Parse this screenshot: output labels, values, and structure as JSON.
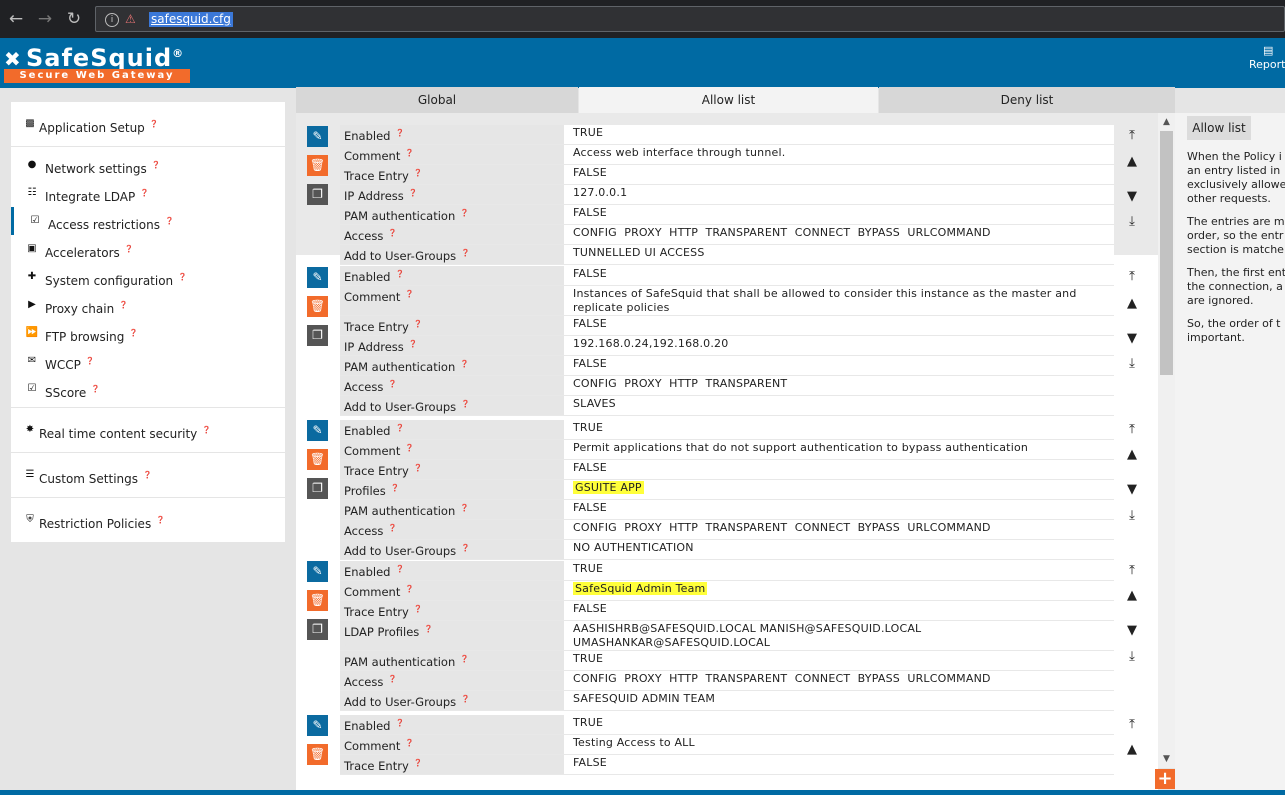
{
  "browser": {
    "url": "safesquid.cfg"
  },
  "app": {
    "logo_name": "SafeSquid",
    "logo_reg": "®",
    "logo_tagline": "Secure Web Gateway",
    "reports_label": "Report"
  },
  "sidebar": {
    "group1_title": "Application Setup",
    "items": [
      "Network settings",
      "Integrate LDAP",
      "Access restrictions",
      "Accelerators",
      "System configuration",
      "Proxy chain",
      "FTP browsing",
      "WCCP",
      "SScore"
    ],
    "group2_title": "Real time content security",
    "group3_title": "Custom Settings",
    "group4_title": "Restriction Policies"
  },
  "tabs": [
    {
      "label": "Global"
    },
    {
      "label": "Allow list"
    },
    {
      "label": "Deny list"
    }
  ],
  "entries": [
    {
      "rows": [
        {
          "k": "Enabled",
          "v": "TRUE"
        },
        {
          "k": "Comment",
          "v": "Access web interface through tunnel."
        },
        {
          "k": "Trace Entry",
          "v": "FALSE"
        },
        {
          "k": "IP Address",
          "v": "127.0.0.1"
        },
        {
          "k": "PAM authentication",
          "v": "FALSE"
        },
        {
          "k": "Access",
          "v": "CONFIG  PROXY  HTTP  TRANSPARENT  CONNECT  BYPASS  URLCOMMAND"
        },
        {
          "k": "Add to User-Groups",
          "v": "TUNNELLED UI ACCESS"
        }
      ]
    },
    {
      "rows": [
        {
          "k": "Enabled",
          "v": "FALSE"
        },
        {
          "k": "Comment",
          "v": "Instances of SafeSquid that shall be allowed to consider this instance as the master and replicate policies"
        },
        {
          "k": "Trace Entry",
          "v": "FALSE"
        },
        {
          "k": "IP Address",
          "v": "192.168.0.24,192.168.0.20"
        },
        {
          "k": "PAM authentication",
          "v": "FALSE"
        },
        {
          "k": "Access",
          "v": "CONFIG  PROXY  HTTP  TRANSPARENT"
        },
        {
          "k": "Add to User-Groups",
          "v": "SLAVES"
        }
      ]
    },
    {
      "rows": [
        {
          "k": "Enabled",
          "v": "TRUE"
        },
        {
          "k": "Comment",
          "v": "Permit applications that do not support authentication to bypass authentication"
        },
        {
          "k": "Trace Entry",
          "v": "FALSE"
        },
        {
          "k": "Profiles",
          "v": "GSUITE APP"
        },
        {
          "k": "PAM authentication",
          "v": "FALSE"
        },
        {
          "k": "Access",
          "v": "CONFIG  PROXY  HTTP  TRANSPARENT  CONNECT  BYPASS  URLCOMMAND"
        },
        {
          "k": "Add to User-Groups",
          "v": "NO AUTHENTICATION"
        }
      ]
    },
    {
      "rows": [
        {
          "k": "Enabled",
          "v": "TRUE"
        },
        {
          "k": "Comment",
          "v": "SafeSquid Admin Team"
        },
        {
          "k": "Trace Entry",
          "v": "FALSE"
        },
        {
          "k": "LDAP Profiles",
          "v": "AASHISHRB@SAFESQUID.LOCAL  MANISH@SAFESQUID.LOCAL UMASHANKAR@SAFESQUID.LOCAL"
        },
        {
          "k": "PAM authentication",
          "v": "TRUE"
        },
        {
          "k": "Access",
          "v": "CONFIG  PROXY  HTTP  TRANSPARENT  CONNECT  BYPASS  URLCOMMAND"
        },
        {
          "k": "Add to User-Groups",
          "v": "SAFESQUID ADMIN TEAM"
        }
      ]
    },
    {
      "rows": [
        {
          "k": "Enabled",
          "v": "TRUE"
        },
        {
          "k": "Comment",
          "v": "Testing Access to ALL"
        },
        {
          "k": "Trace Entry",
          "v": "FALSE"
        }
      ]
    }
  ],
  "help": {
    "title": "Allow list",
    "p1": "When the Policy i an entry listed in exclusively allowe other requests.",
    "p2": "The entries are m order, so the entr section is matche",
    "p3": "Then, the first ent the connection, a are ignored.",
    "p4": "So, the order of t important."
  },
  "colors": {
    "brand_blue": "#006aa3",
    "accent_orange": "#f26b2b",
    "highlight_yellow": "#ffff3a"
  },
  "icons": {
    "edit": "edit-icon",
    "delete": "trash-icon",
    "copy": "copy-icon",
    "move_top": "arrow-up-circle-icon",
    "move_up": "triangle-up-icon",
    "move_down": "triangle-down-icon",
    "move_bottom": "arrow-down-circle-icon",
    "add": "plus-icon"
  }
}
